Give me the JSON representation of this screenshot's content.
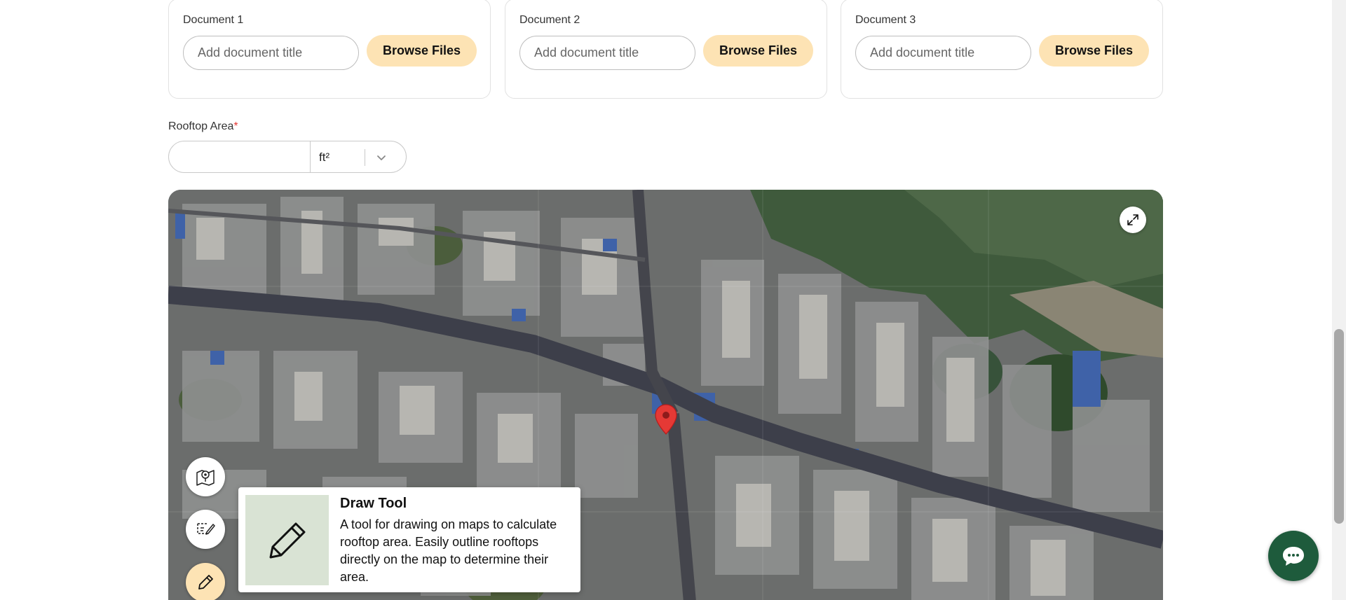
{
  "documents": [
    {
      "label": "Document 1",
      "placeholder": "Add document title",
      "button": "Browse Files"
    },
    {
      "label": "Document 2",
      "placeholder": "Add document title",
      "button": "Browse Files"
    },
    {
      "label": "Document 3",
      "placeholder": "Add document title",
      "button": "Browse Files"
    }
  ],
  "rooftop": {
    "label": "Rooftop Area",
    "required_mark": "*",
    "value": "",
    "unit": "ft²"
  },
  "map": {
    "expand_icon": "expand-icon",
    "pin_icon": "location-pin-icon",
    "tools": [
      "map-location-icon",
      "select-edit-icon",
      "pencil-icon"
    ],
    "tooltip": {
      "title": "Draw Tool",
      "description": "A tool for drawing on maps to calculate rooftop area. Easily outline rooftops directly on the map to determine their area."
    }
  },
  "chat": {
    "icon": "chat-bubble-icon"
  },
  "colors": {
    "accent": "#fde3b4",
    "chat": "#1e5b3c",
    "required": "#e53935",
    "pin": "#e53935"
  }
}
